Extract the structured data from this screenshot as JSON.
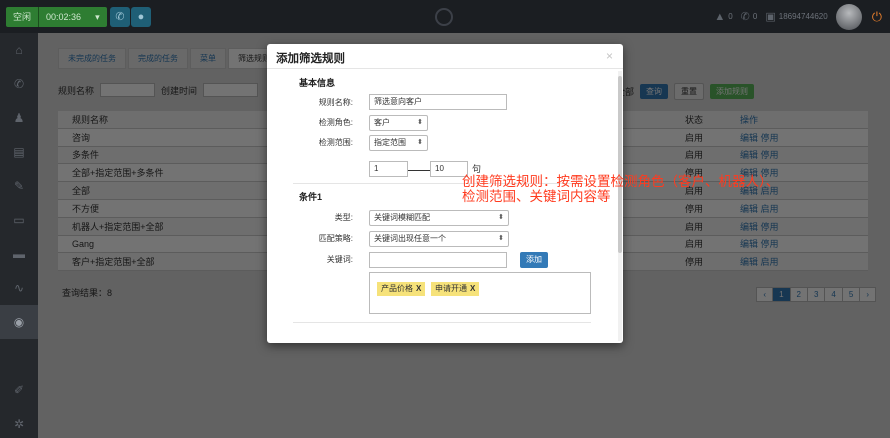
{
  "topbar": {
    "status": "空闲",
    "timer": "00:02:36",
    "user_count": "0",
    "call_count": "0",
    "phone_number": "18694744620"
  },
  "bg": {
    "tabs": [
      "未完成的任务",
      "完成的任务",
      "菜单",
      "筛选规则"
    ],
    "filter_label_name": "规则名称",
    "filter_label_time": "创建时间",
    "filter_select": "全部",
    "btn_query": "查询",
    "btn_reset": "重置",
    "btn_add": "添加规则",
    "col_name": "规则名称",
    "col_status": "状态",
    "col_ops": "操作",
    "rows": [
      {
        "name": "规则名称",
        "status": "状态",
        "ops": "操作"
      },
      {
        "name": "咨询",
        "status": "启用",
        "ops": "编辑 停用"
      },
      {
        "name": "多条件",
        "status": "启用",
        "ops": "编辑 停用"
      },
      {
        "name": "全部+指定范围+多条件",
        "status": "停用",
        "ops": "编辑 停用"
      },
      {
        "name": "全部",
        "status": "启用",
        "ops": "编辑 启用"
      },
      {
        "name": "不方便",
        "status": "停用",
        "ops": "编辑 启用"
      },
      {
        "name": "机器人+指定范围+全部",
        "status": "启用",
        "ops": "编辑 停用"
      },
      {
        "name": "Gang",
        "status": "启用",
        "ops": "编辑 停用"
      },
      {
        "name": "客户+指定范围+全部",
        "status": "停用",
        "ops": "编辑 启用"
      }
    ],
    "query_result": "查询结果：8",
    "pager": [
      "‹",
      "1",
      "2",
      "3",
      "4",
      "5",
      "›"
    ]
  },
  "modal": {
    "title": "添加筛选规则",
    "close": "×",
    "section_basic": "基本信息",
    "rule_name_label": "规则名称:",
    "rule_name_value": "筛选意向客户",
    "role_label": "检测角色:",
    "role_value": "客户",
    "range_label": "检测范围:",
    "range_value": "指定范围",
    "range_from": "1",
    "range_to": "10",
    "range_unit": "句",
    "section_cond": "条件1",
    "type_label": "类型:",
    "type_value": "关键词模糊匹配",
    "strategy_label": "匹配策略:",
    "strategy_value": "关键词出现任意一个",
    "keyword_label": "关键词:",
    "add_button": "添加",
    "tags": [
      {
        "text": "产品价格",
        "x": "X"
      },
      {
        "text": "申请开通",
        "x": "X"
      }
    ]
  },
  "annotation": {
    "line1": "创建筛选规则：按需设置检测角色（客户、机器人）、",
    "line2": "检测范围、关键词内容等"
  }
}
